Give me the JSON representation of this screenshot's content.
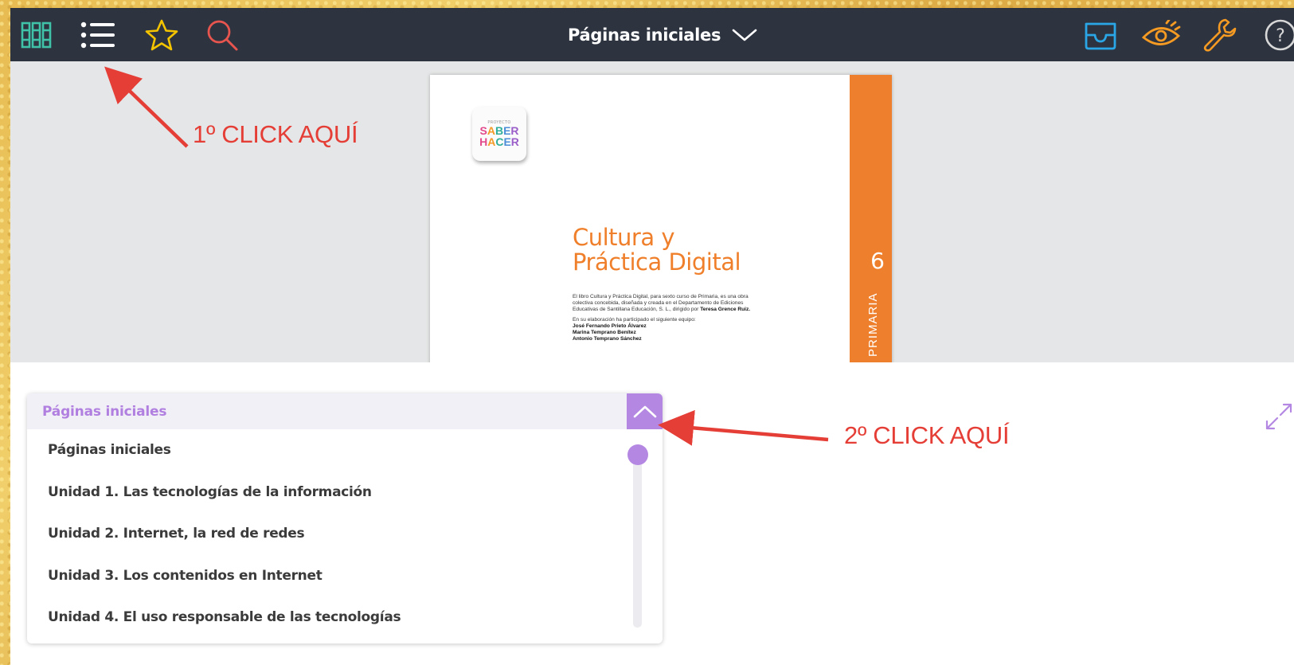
{
  "toolbar": {
    "title": "Páginas iniciales",
    "icons": [
      "library-icon",
      "index-list-icon",
      "star-icon",
      "search-icon",
      "tray-icon",
      "eye-icon",
      "wrench-icon",
      "help-icon"
    ]
  },
  "book_page": {
    "logo_small": "PROYECTO",
    "logo_line1": [
      "S",
      "A",
      "B",
      "E",
      "R"
    ],
    "logo_line2": [
      "H",
      "A",
      "C",
      "E",
      "R"
    ],
    "title_line1": "Cultura y",
    "title_line2": "Práctica Digital",
    "paragraph1_a": "El libro Cultura y Práctica Digital, para sexto curso de Primaria, es una obra",
    "paragraph1_b": "colectiva concebida, diseñada y creada en el Departamento de Ediciones",
    "paragraph1_c": "Educativas de Santillana Educación, S. L., dirigido por",
    "director": "Teresa Grence Ruiz.",
    "paragraph2": "En su elaboración ha participado el siguiente equipo:",
    "team": [
      "José Fernando Prieto Álvarez",
      "Marina Temprano Benítez",
      "Antonio Temprano Sánchez"
    ],
    "band_number": "6",
    "band_label": "PRIMARIA"
  },
  "dropdown": {
    "selected": "Páginas iniciales",
    "items": [
      "Páginas iniciales",
      "Unidad 1. Las tecnologías de la información",
      "Unidad 2. Internet, la red de redes",
      "Unidad 3. Los contenidos en Internet",
      "Unidad 4. El uso responsable de las tecnologías"
    ]
  },
  "annotations": {
    "first": "1º CLICK AQUÍ",
    "second": "2º CLICK AQUÍ"
  },
  "colors": {
    "toolbar_bg": "#2d3440",
    "accent_purple": "#b488e2",
    "book_orange": "#ee7f2d",
    "annotation_red": "#e53e36"
  }
}
